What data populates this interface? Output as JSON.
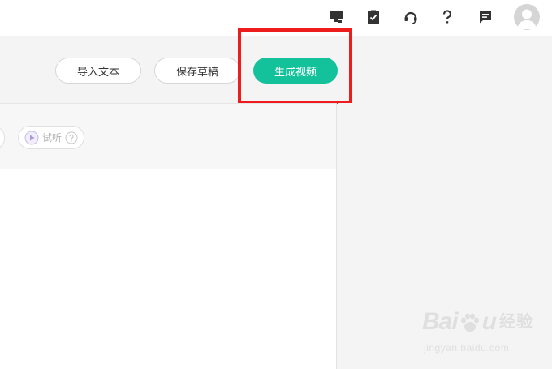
{
  "topbar": {
    "icons": [
      "monitor-icon",
      "clipboard-check-icon",
      "headset-icon",
      "help-icon",
      "message-icon"
    ],
    "avatar": "avatar"
  },
  "toolbar": {
    "import_label": "导入文本",
    "draft_label": "保存草稿",
    "generate_label": "生成视频"
  },
  "editor": {
    "preview_label": "试听"
  },
  "watermark": {
    "brand_a": "Bai",
    "brand_b": "u",
    "brand_cn": "经验",
    "url": "jingyan.baidu.com"
  },
  "colors": {
    "primary": "#13c29b",
    "highlight": "#ee1c1c",
    "background": "#f4f4f4",
    "icon": "#333333"
  }
}
